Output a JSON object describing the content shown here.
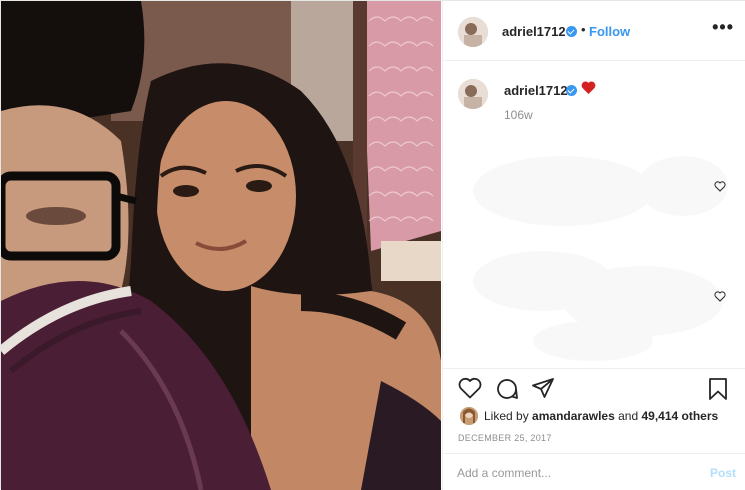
{
  "header": {
    "username": "adriel1712",
    "separator": "•",
    "follow_label": "Follow",
    "more_label": "•••"
  },
  "caption": {
    "username": "adriel1712",
    "emoji": "heart",
    "time_ago": "106w"
  },
  "actions": {
    "like_icon": "heart-outline-icon",
    "comment_icon": "comment-icon",
    "share_icon": "paper-plane-icon",
    "save_icon": "bookmark-icon"
  },
  "likes": {
    "prefix": "Liked by",
    "user": "amandarawles",
    "middle": "and",
    "count": "49,414 others"
  },
  "date": "DECEMBER 25, 2017",
  "comment": {
    "placeholder": "Add a comment...",
    "post_label": "Post"
  },
  "colors": {
    "link": "#3897f0",
    "heart": "#ed4956",
    "muted": "#8e8e8e"
  }
}
